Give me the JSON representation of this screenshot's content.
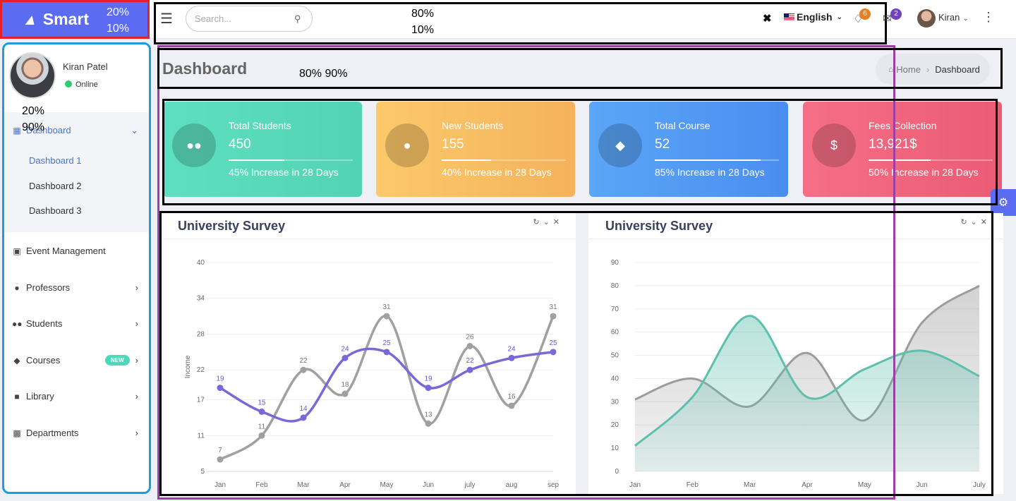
{
  "brand": {
    "name": "Smart",
    "logo_icon": "smart-logo-icon",
    "annotation_line1": "20%",
    "annotation_line2": "10%"
  },
  "header": {
    "search_placeholder": "Search...",
    "annotation_line1": "80%",
    "annotation_line2": "10%",
    "language": "English",
    "notifications_count": "6",
    "messages_count": "2",
    "user_name": "Kiran"
  },
  "sidebar": {
    "profile": {
      "name": "Kiran Patel",
      "status": "Online"
    },
    "annotation_line1": "20%",
    "annotation_line2": "90%",
    "dashboard_label": "Dashboard",
    "dashboard_sub": [
      "Dashboard 1",
      "Dashboard 2",
      "Dashboard 3"
    ],
    "items": [
      {
        "label": "Event Management",
        "icon": "calendar-icon"
      },
      {
        "label": "Professors",
        "icon": "person-icon"
      },
      {
        "label": "Students",
        "icon": "group-icon"
      },
      {
        "label": "Courses",
        "icon": "graduation-cap-icon",
        "badge": "NEW"
      },
      {
        "label": "Library",
        "icon": "book-icon"
      },
      {
        "label": "Departments",
        "icon": "building-icon"
      }
    ]
  },
  "page": {
    "title": "Dashboard",
    "annotation": "80% 90%",
    "breadcrumb": {
      "home": "Home",
      "current": "Dashboard"
    }
  },
  "cards": [
    {
      "title": "Total Students",
      "value": "450",
      "subtext": "45% Increase in 28 Days",
      "progress": 0.45,
      "color_from": "#5ee0c0",
      "color_to": "#52d3b3",
      "icon": "group-icon"
    },
    {
      "title": "New Students",
      "value": "155",
      "subtext": "40% Increase in 28 Days",
      "progress": 0.4,
      "color_from": "#fcc96a",
      "color_to": "#f4b25a",
      "icon": "person-icon"
    },
    {
      "title": "Total Course",
      "value": "52",
      "subtext": "85% Increase in 28 Days",
      "progress": 0.85,
      "color_from": "#5aa6f7",
      "color_to": "#4a8df0",
      "icon": "graduation-cap-icon"
    },
    {
      "title": "Fees Collection",
      "value": "13,921$",
      "subtext": "50% Increase in 28 Days",
      "progress": 0.5,
      "color_from": "#f56f87",
      "color_to": "#ec5b73",
      "icon": "dollar-icon"
    }
  ],
  "panels": [
    {
      "title": "University Survey"
    },
    {
      "title": "University Survey"
    }
  ],
  "chart_data": [
    {
      "type": "line",
      "title": "University Survey",
      "ylabel": "Income",
      "categories": [
        "Jan",
        "Feb",
        "Mar",
        "Apr",
        "May",
        "Jun",
        "july",
        "aug",
        "sep"
      ],
      "yticks": [
        5,
        11,
        17,
        22,
        28,
        34,
        40
      ],
      "ylim": [
        5,
        40
      ],
      "grid": true,
      "series": [
        {
          "values": [
            7,
            11,
            22,
            18,
            31,
            13,
            26,
            16,
            31
          ],
          "color": "#a0a0a0"
        },
        {
          "values": [
            19,
            15,
            14,
            24,
            25,
            19,
            22,
            24,
            25
          ],
          "color": "#7b68d8"
        }
      ]
    },
    {
      "type": "area",
      "title": "University Survey",
      "categories": [
        "Jan",
        "Feb",
        "Mar",
        "Apr",
        "May",
        "Jun",
        "July"
      ],
      "yticks": [
        0,
        10,
        20,
        30,
        40,
        50,
        60,
        70,
        80,
        90
      ],
      "ylim": [
        0,
        90
      ],
      "grid": true,
      "series": [
        {
          "values": [
            31,
            40,
            28,
            51,
            22,
            64,
            80
          ],
          "color": "#9c9c9c"
        },
        {
          "values": [
            11,
            32,
            67,
            32,
            44,
            52,
            41
          ],
          "color": "#5fbfad"
        }
      ]
    }
  ]
}
